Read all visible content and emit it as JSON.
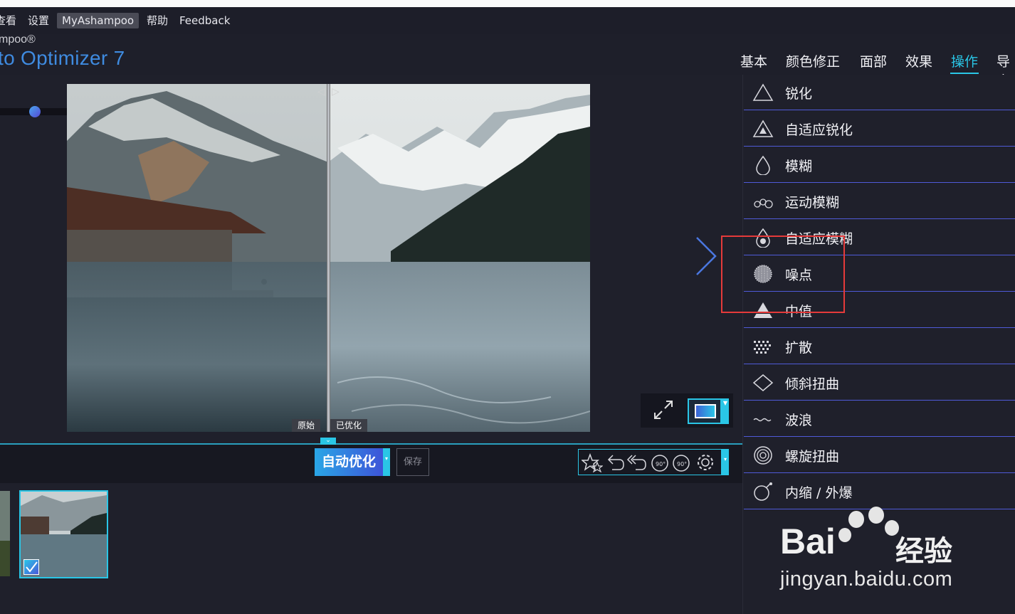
{
  "menu": {
    "items": [
      {
        "label": "查看",
        "active": false
      },
      {
        "label": "设置",
        "active": false
      },
      {
        "label": "MyAshampoo",
        "active": true
      },
      {
        "label": "帮助",
        "active": false
      },
      {
        "label": "Feedback",
        "active": false
      }
    ]
  },
  "brand": {
    "small": "mpoo®",
    "big": "to Optimizer 7"
  },
  "tabs": [
    {
      "label": "基本",
      "active": false
    },
    {
      "label": "颜色修正",
      "active": false
    },
    {
      "label": "面部",
      "active": false
    },
    {
      "label": "效果",
      "active": false
    },
    {
      "label": "操作",
      "active": true
    },
    {
      "label": "导出",
      "active": false
    }
  ],
  "preview": {
    "zoom_plus": "+",
    "label_original": "原始",
    "label_optimized": "已优化"
  },
  "toolbar": {
    "auto_optimize_label": "自动优化",
    "save_label": "保存",
    "tools": [
      "magic-wand-icon",
      "undo-icon",
      "undo-all-icon",
      "rotate-left-90-icon",
      "rotate-right-90-icon",
      "settings-gear-icon"
    ],
    "rotate_left_text": "90°",
    "rotate_right_text": "90°"
  },
  "operations": [
    {
      "label": "锐化",
      "icon": "triangle-sharpen-icon"
    },
    {
      "label": "自适应锐化",
      "icon": "adaptive-sharpen-icon"
    },
    {
      "label": "模糊",
      "icon": "drop-blur-icon"
    },
    {
      "label": "运动模糊",
      "icon": "motion-blur-icon"
    },
    {
      "label": "自适应模糊",
      "icon": "adaptive-blur-icon"
    },
    {
      "label": "噪点",
      "icon": "noise-icon"
    },
    {
      "label": "中值",
      "icon": "median-icon"
    },
    {
      "label": "扩散",
      "icon": "diffuse-icon"
    },
    {
      "label": "倾斜扭曲",
      "icon": "skew-icon"
    },
    {
      "label": "波浪",
      "icon": "wave-icon"
    },
    {
      "label": "螺旋扭曲",
      "icon": "swirl-icon"
    },
    {
      "label": "内缩 / 外爆",
      "icon": "implode-explode-icon"
    }
  ],
  "watermark": {
    "brand": "Bai",
    "brand_suffix": "经验",
    "url": "jingyan.baidu.com"
  },
  "colors": {
    "accent": "#2ac6e6",
    "brand_blue": "#3f8be0",
    "highlight_red": "#e53a3a"
  }
}
